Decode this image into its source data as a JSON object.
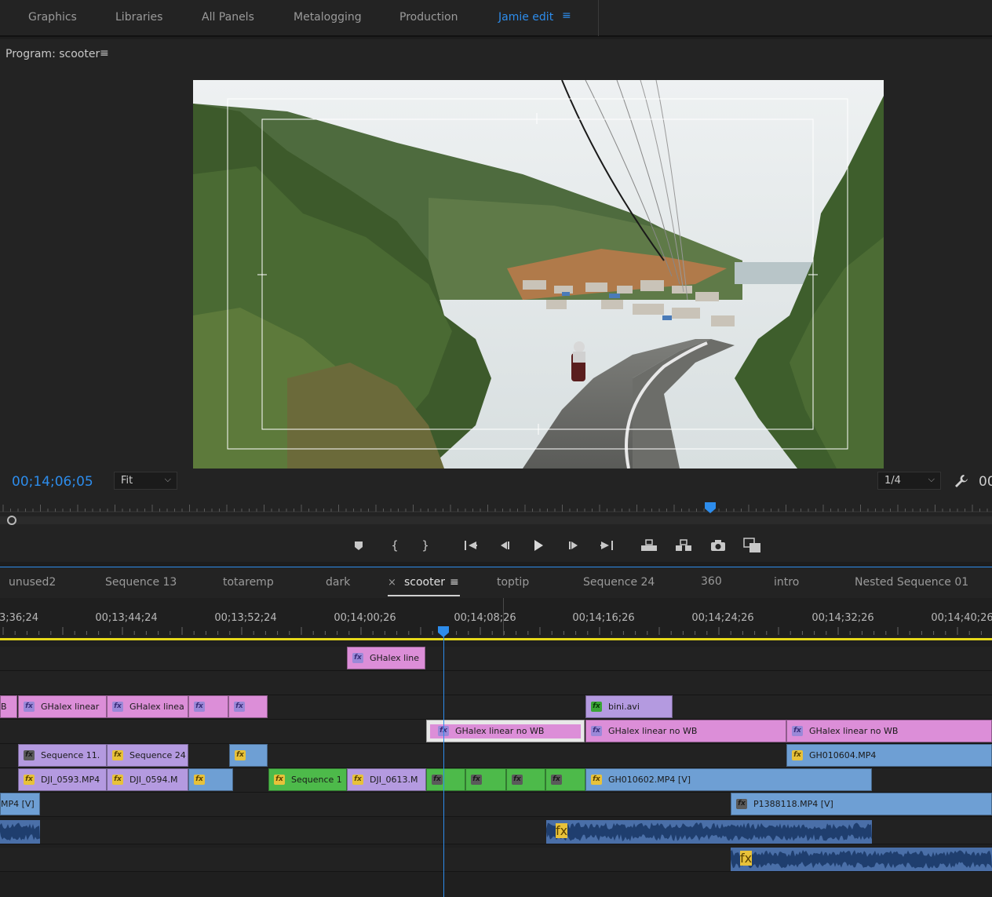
{
  "workspaces": [
    {
      "label": "Graphics",
      "active": false
    },
    {
      "label": "Libraries",
      "active": false
    },
    {
      "label": "All Panels",
      "active": false
    },
    {
      "label": "Metalogging",
      "active": false
    },
    {
      "label": "Production",
      "active": false
    },
    {
      "label": "Jamie edit",
      "active": true
    }
  ],
  "monitor": {
    "title": "Program: scooter",
    "timecode": "00;14;06;05",
    "zoom": "Fit",
    "resolution": "1/4",
    "timecode_cut": "00"
  },
  "sequence_tabs": [
    {
      "label": "unused2"
    },
    {
      "label": "Sequence 13"
    },
    {
      "label": "totaremp"
    },
    {
      "label": "dark"
    },
    {
      "label": "scooter",
      "active": true
    },
    {
      "label": "toptip"
    },
    {
      "label": "Sequence 24"
    },
    {
      "label": "360"
    },
    {
      "label": "intro"
    },
    {
      "label": "Nested Sequence 01"
    }
  ],
  "timeline": {
    "ruler": [
      "3;36;24",
      "00;13;44;24",
      "00;13;52;24",
      "00;14;00;26",
      "00;14;08;26",
      "00;14;16;26",
      "00;14;24;26",
      "00;14;32;26",
      "00;14;40;26"
    ],
    "clips": {
      "v6_1": "GHalex line",
      "v5_0": "B",
      "v5_1": "GHalex linear",
      "v5_2": "GHalex linea",
      "v5_5": "bini.avi",
      "v4_1": "GHalex linear no WB",
      "v4_2": "GHalex linear no WB",
      "v4_3": "GHalex linear no WB",
      "v3_1": "Sequence 11.",
      "v3_2": "Sequence 24",
      "v3_4": "GH010604.MP4",
      "v2_1": "DJI_0593.MP4",
      "v2_2": "DJI_0594.M",
      "v2_4": "Sequence 1",
      "v2_5": "DJI_0613.M",
      "v2_10": "GH010602.MP4 [V]",
      "v1_0": "MP4 [V]",
      "v1_1": "P1388118.MP4 [V]"
    }
  },
  "icons": [
    "menu-icon",
    "wrench-icon",
    "add-marker-icon",
    "mark-in-icon",
    "mark-out-icon",
    "go-to-in-icon",
    "step-back-icon",
    "play-icon",
    "step-forward-icon",
    "go-to-out-icon",
    "lift-icon",
    "extract-icon",
    "export-frame-icon",
    "comparison-view-icon",
    "fx-badge-icon"
  ],
  "colors": {
    "accent": "#2d8ceb",
    "work_area": "#e6d81a",
    "pink_clip": "#dc8ed8",
    "violet_clip": "#b49ae0",
    "blue_clip": "#6e9fd4",
    "green_clip": "#4dba4a"
  }
}
